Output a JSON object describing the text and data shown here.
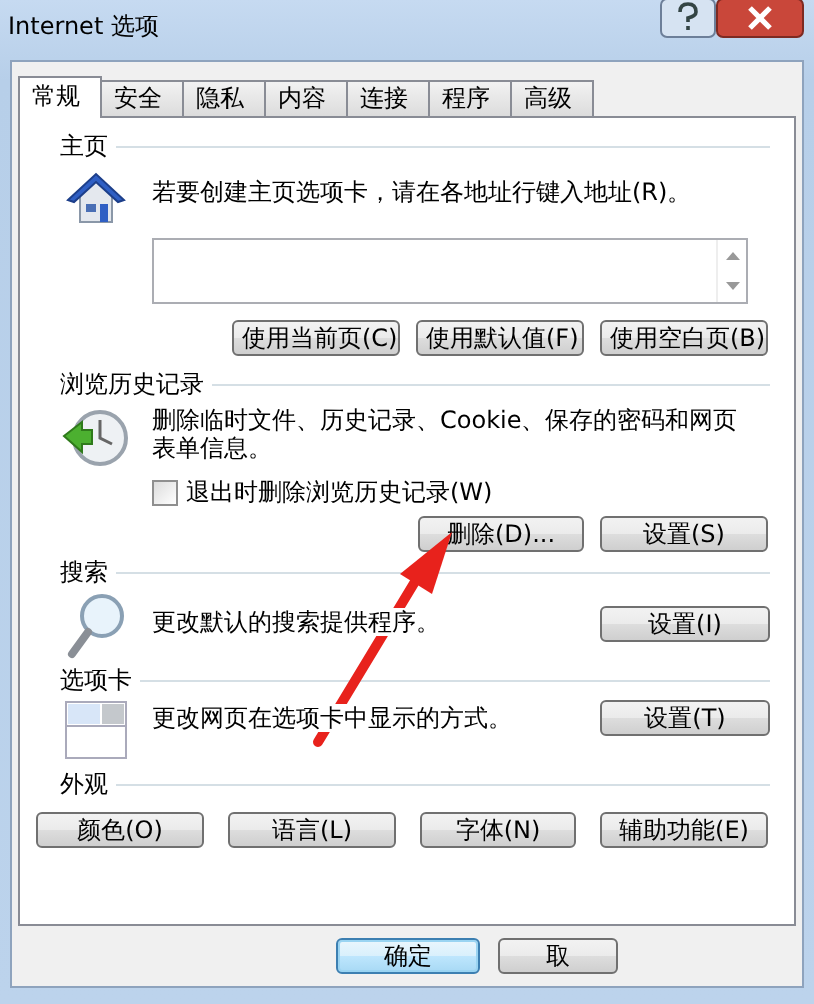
{
  "window": {
    "title": "Internet 选项"
  },
  "tabs": [
    {
      "label": "常规",
      "selected": true
    },
    {
      "label": "安全",
      "selected": false
    },
    {
      "label": "隐私",
      "selected": false
    },
    {
      "label": "内容",
      "selected": false
    },
    {
      "label": "连接",
      "selected": false
    },
    {
      "label": "程序",
      "selected": false
    },
    {
      "label": "高级",
      "selected": false
    }
  ],
  "sections": [
    {
      "kind": "homepage",
      "heading": "主页",
      "description": "若要创建主页选项卡，请在各地址行键入地址(R)。",
      "field": {
        "kind": "textarea"
      },
      "buttons": [
        "使用当前页(C)",
        "使用默认值(F)",
        "使用空白页(B)"
      ]
    },
    {
      "kind": "history",
      "heading": "浏览历史记录",
      "description": "删除临时文件、历史记录、Cookie、保存的密码和网页表单信息。",
      "checkbox": {
        "label": "退出时删除浏览历史记录(W)",
        "checked": false
      },
      "buttons": [
        "删除(D)...",
        "设置(S)"
      ]
    },
    {
      "kind": "search",
      "heading": "搜索",
      "description": "更改默认的搜索提供程序。",
      "buttons": [
        "设置(I)"
      ]
    },
    {
      "kind": "tabs",
      "heading": "选项卡",
      "description": "更改网页在选项卡中显示的方式。",
      "buttons": [
        "设置(T)"
      ]
    },
    {
      "kind": "appearance",
      "heading": "外观",
      "buttons": [
        "颜色(O)",
        "语言(L)",
        "字体(N)",
        "辅助功能(E)"
      ]
    }
  ],
  "footer_buttons": [
    {
      "label": "确定",
      "selected": true
    },
    {
      "label": "取",
      "selected": false
    }
  ],
  "annotation": {
    "kind": "arrow"
  }
}
